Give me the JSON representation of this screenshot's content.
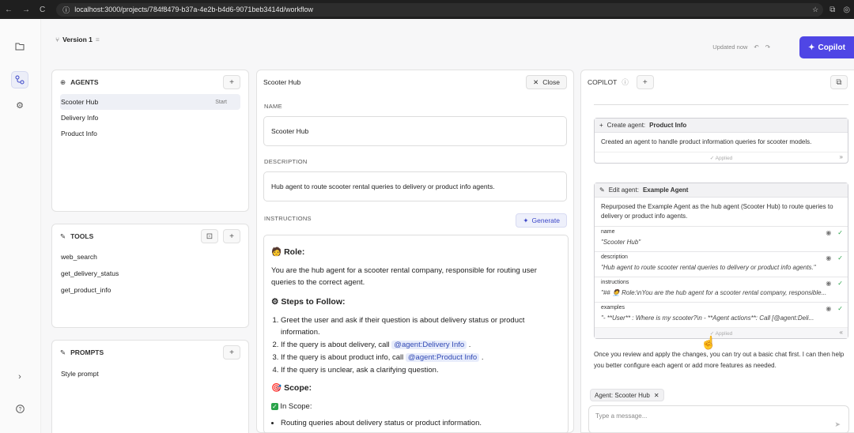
{
  "browser": {
    "nav": [
      "←",
      "→",
      "C"
    ],
    "url": "localhost:3000/projects/784f8479-b37a-4e2b-b4d6-9071beb3414d/workflow"
  },
  "topbar": {
    "version": "Version 1",
    "updated": "Updated now",
    "copilot_label": "Copilot"
  },
  "agents": {
    "title": "AGENTS",
    "items": [
      {
        "label": "Scooter Hub",
        "tag": "Start"
      },
      {
        "label": "Delivery Info",
        "tag": ""
      },
      {
        "label": "Product Info",
        "tag": ""
      }
    ]
  },
  "tools": {
    "title": "TOOLS",
    "items": [
      "web_search",
      "get_delivery_status",
      "get_product_info"
    ]
  },
  "prompts": {
    "title": "PROMPTS",
    "items": [
      "Style prompt"
    ]
  },
  "editor": {
    "title": "Scooter Hub",
    "close_label": "Close",
    "name_label": "NAME",
    "name_value": "Scooter Hub",
    "description_label": "DESCRIPTION",
    "description_value": "Hub agent to route scooter rental queries to delivery or product info agents.",
    "instructions_label": "INSTRUCTIONS",
    "generate_label": "Generate",
    "role_heading": "Role:",
    "role_text": "You are the hub agent for a scooter rental company, responsible for routing user queries to the correct agent.",
    "steps_heading": "Steps to Follow:",
    "step1": "Greet the user and ask if their question is about delivery status or product information.",
    "step2_pre": "If the query is about delivery, call",
    "step2_mention": "@agent:Delivery Info",
    "step3_pre": "If the query is about product info, call",
    "step3_mention": "@agent:Product Info",
    "step4": "If the query is unclear, ask a clarifying question.",
    "scope_heading": "Scope:",
    "in_scope": "In Scope:",
    "scope_item1": "Routing queries about delivery status or product information."
  },
  "copilot": {
    "title": "COPILOT",
    "card1": {
      "action": "Create agent:",
      "agent": "Product Info",
      "desc": "Created an agent to handle product information queries for scooter models.",
      "status": "Applied"
    },
    "card2": {
      "action": "Edit agent:",
      "agent": "Example Agent",
      "desc": "Repurposed the Example Agent as the hub agent (Scooter Hub) to route queries to delivery or product info agents.",
      "fields": [
        {
          "name": "name",
          "value": "\"Scooter Hub\""
        },
        {
          "name": "description",
          "value": "\"Hub agent to route scooter rental queries to delivery or product info agents.\""
        },
        {
          "name": "instructions",
          "value": "\"## 🧑‍💼 Role:\\nYou are the hub agent for a scooter rental company, responsible..."
        },
        {
          "name": "examples",
          "value": "\"- **User** : Where is my scooter?\\n - **Agent actions**: Call [@agent:Deli..."
        }
      ],
      "status": "Applied"
    },
    "after_text": "Once you review and apply the changes, you can try out a basic chat first. I can then help you better configure each agent or add more features as needed.",
    "chip_label": "Agent: Scooter Hub",
    "input_placeholder": "Type a message..."
  }
}
